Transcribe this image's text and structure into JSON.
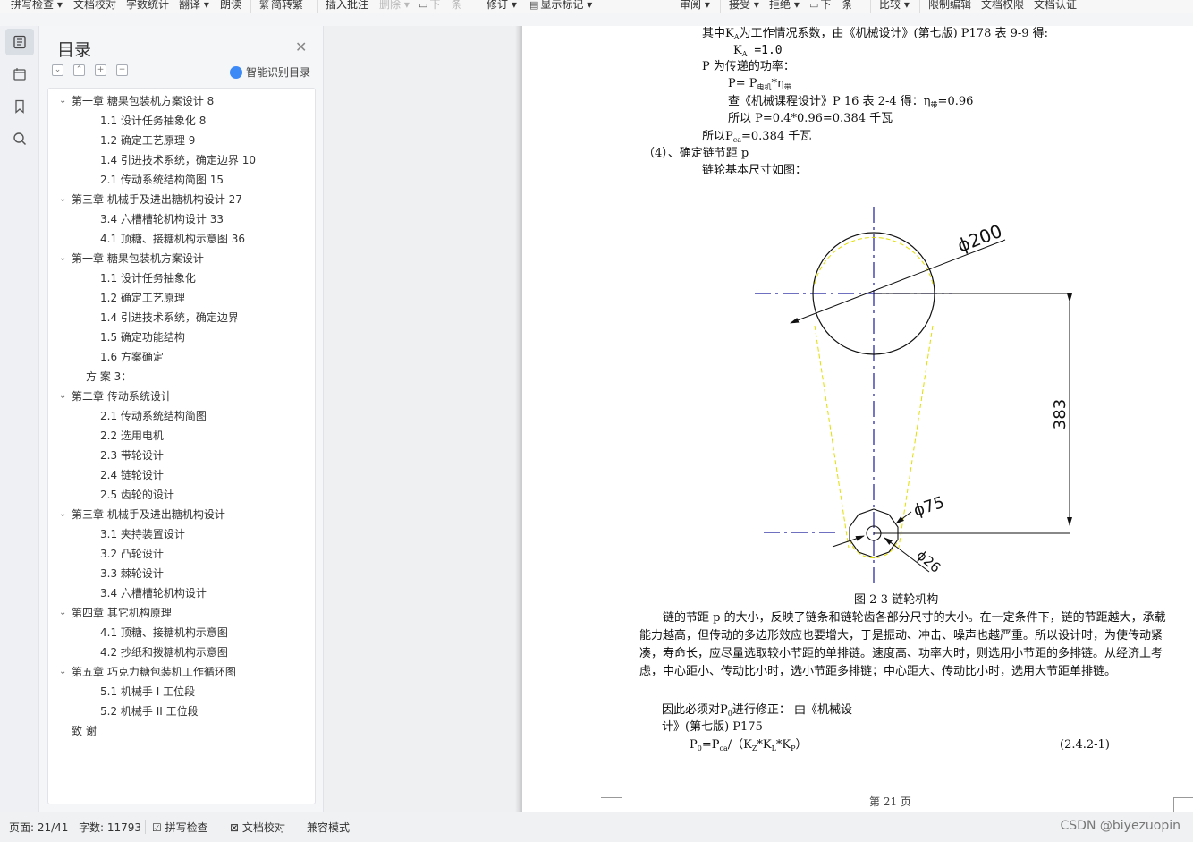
{
  "toolbar": {
    "items": [
      "拼写检查",
      "文档校对",
      "字数统计",
      "翻译",
      "朗读",
      "简转繁",
      "插入批注",
      "删除",
      "下一条",
      "修订",
      "显示标记",
      "审阅",
      "接受",
      "拒绝",
      "下一条",
      "比较",
      "限制编辑",
      "文档权限",
      "文档认证"
    ]
  },
  "toc": {
    "title": "目录",
    "smart_label": "智能识别目录",
    "items": [
      {
        "level": 1,
        "text": "第一章  糖果包装机方案设计  8",
        "expanded": true
      },
      {
        "level": 2,
        "text": "1.1 设计任务抽象化  8"
      },
      {
        "level": 2,
        "text": "1.2 确定工艺原理  9"
      },
      {
        "level": 2,
        "text": "1.4 引进技术系统，确定边界  10"
      },
      {
        "level": 2,
        "text": "2.1 传动系统结构简图  15"
      },
      {
        "level": 1,
        "text": "第三章  机械手及进出糖机构设计  27",
        "expanded": true
      },
      {
        "level": 2,
        "text": "3.4 六槽槽轮机构设计  33"
      },
      {
        "level": 2,
        "text": "4.1 顶糖、接糖机构示意图  36"
      },
      {
        "level": 1,
        "text": "第一章  糖果包装机方案设计",
        "expanded": true
      },
      {
        "level": 2,
        "text": "1.1 设计任务抽象化"
      },
      {
        "level": 2,
        "text": "1.2 确定工艺原理"
      },
      {
        "level": 2,
        "text": "1.4 引进技术系统，确定边界"
      },
      {
        "level": 2,
        "text": "1.5 确定功能结构"
      },
      {
        "level": 2,
        "text": "1.6 方案确定"
      },
      {
        "level": 1.5,
        "text": "方 案 3："
      },
      {
        "level": 1,
        "text": "第二章  传动系统设计",
        "expanded": true
      },
      {
        "level": 2,
        "text": "2.1 传动系统结构简图"
      },
      {
        "level": 2,
        "text": "2.2 选用电机"
      },
      {
        "level": 2,
        "text": "2.3 带轮设计"
      },
      {
        "level": 2,
        "text": "2.4 链轮设计"
      },
      {
        "level": 2,
        "text": "2.5 齿轮的设计"
      },
      {
        "level": 1,
        "text": "第三章  机械手及进出糖机构设计",
        "expanded": true
      },
      {
        "level": 2,
        "text": "3.1 夹持装置设计"
      },
      {
        "level": 2,
        "text": "3.2 凸轮设计"
      },
      {
        "level": 2,
        "text": "3.3 棘轮设计"
      },
      {
        "level": 2,
        "text": "3.4 六槽槽轮机构设计"
      },
      {
        "level": 1,
        "text": "第四章  其它机构原理",
        "expanded": true
      },
      {
        "level": 2,
        "text": "4.1 顶糖、接糖机构示意图"
      },
      {
        "level": 2,
        "text": "4.2 抄纸和拨糖机构示意图"
      },
      {
        "level": 1,
        "text": "第五章  巧克力糖包装机工作循环图",
        "expanded": true
      },
      {
        "level": 2,
        "text": "5.1 机械手 I 工位段"
      },
      {
        "level": 2,
        "text": "5.2 机械手 II 工位段"
      },
      {
        "level": 1.2,
        "text": "致  谢"
      }
    ]
  },
  "document": {
    "l1a": "其中K",
    "l1sub": "A",
    "l1b": "为工作情况系数，由《机械设计》(第七版) P178 表 9-9 得:",
    "l2a": "K",
    "l2sub": "A",
    "l2b": " =1.0",
    "l3": "P 为传递的功率：",
    "l4a": "P= P",
    "l4sub": "电机",
    "l4b": "*η",
    "l4sub2": "带",
    "l5a": "查《机械课程设计》P 16 表 2-4 得：η",
    "l5sub": "带",
    "l5b": "=0.96",
    "l6": "所以 P=0.4*0.96=0.384 千瓦",
    "l7a": "所以P",
    "l7sub": "ca",
    "l7b": "=0.384 千瓦",
    "l8": "（4）、确定链节距 p",
    "l9": "链轮基本尺寸如图：",
    "fig": {
      "dim_big": "ϕ200",
      "dim_mid": "ϕ75",
      "dim_small": "ϕ26",
      "dim_center": "383",
      "caption": "图 2-3   链轮机构"
    },
    "para1": "链的节距 p 的大小，反映了链条和链轮齿各部分尺寸的大小。在一定条件下，链的节距越大，承载能力越高，但传动的多边形效应也要增大，于是振动、冲击、噪声也越严重。所以设计时，为使传动紧凑，寿命长，应尽量选取较小节距的单排链。速度高、功率大时，则选用小节距的多排链。从经济上考虑，中心距小、传动比小时，选小节距多排链；中心距大、传动比小时，选用大节距单排链。",
    "l10a": "因此必须对P",
    "l10sub": "0",
    "l10b": "进行修正：  由《机械设",
    "l11": "计》(第七版) P175",
    "l12a": "P",
    "l12sub": "0",
    "l12b": "=P",
    "l12sub2": "ca",
    "l12c": "/（K",
    "l12sub3": "Z",
    "l12d": "*K",
    "l12sub4": "L",
    "l12e": "*K",
    "l12sub5": "P",
    "l12f": "）",
    "eqno": "(2.4.2-1)",
    "footer": "第    21    页"
  },
  "status": {
    "page": "页面: 21/41",
    "words": "字数: 11793",
    "spell": "拼写检查",
    "proof": "文档校对",
    "compat": "兼容模式",
    "watermark": "CSDN @biyezuopin"
  }
}
